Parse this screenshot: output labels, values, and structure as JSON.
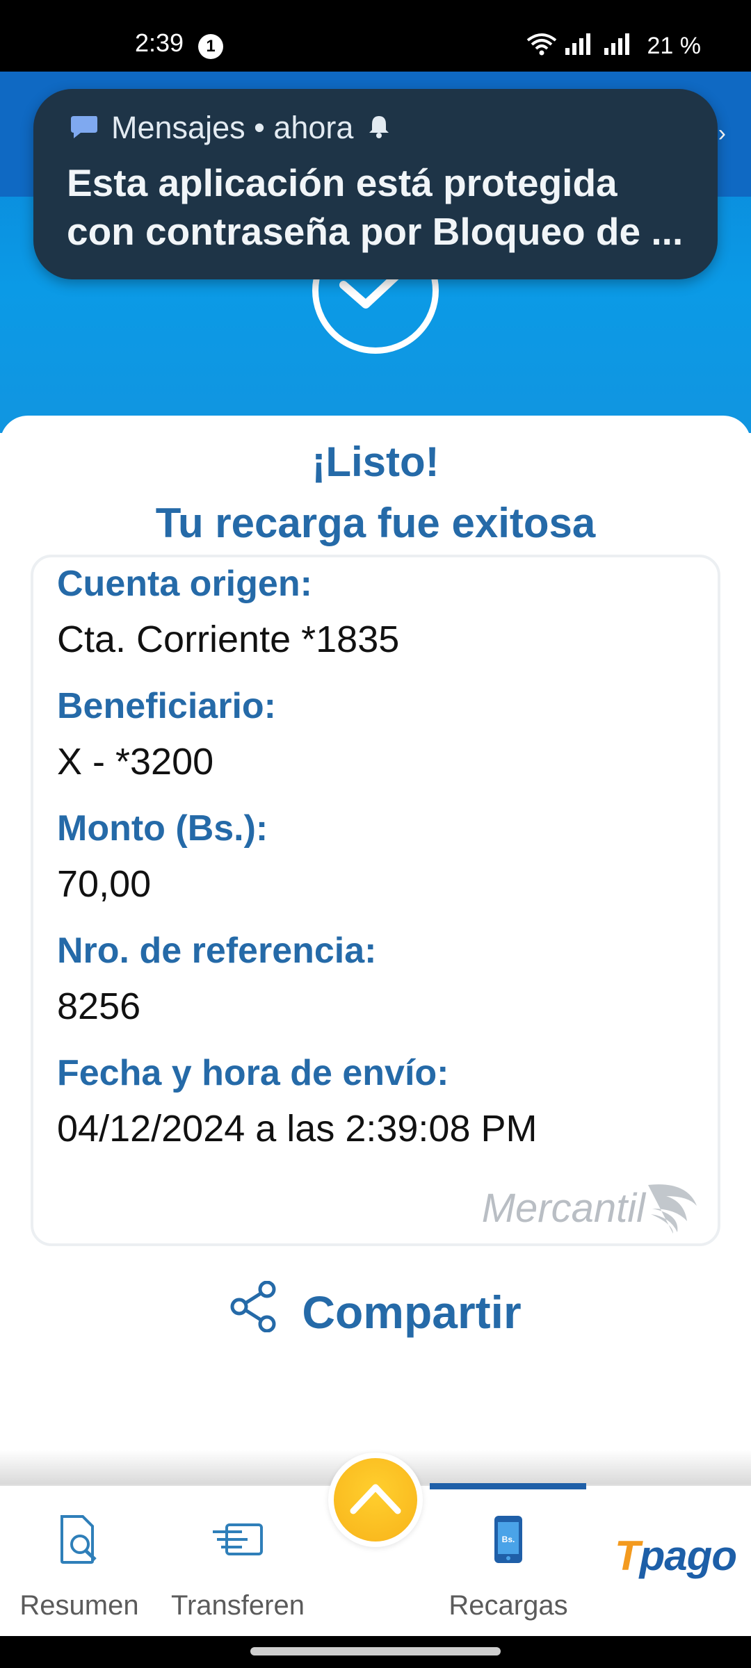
{
  "status_bar": {
    "time": "2:39",
    "notification_count": "1",
    "battery": "21 %"
  },
  "notification": {
    "app": "Mensajes • ahora",
    "line1": "Esta aplicación está protegida",
    "line2": "con contraseña por Bloqueo de ..."
  },
  "result": {
    "title": "¡Listo!",
    "subtitle": "Tu recarga fue exitosa"
  },
  "details": {
    "account_label": "Cuenta origen:",
    "account_value": "Cta. Corriente *1835",
    "beneficiary_label": "Beneficiario:",
    "beneficiary_value": "X - *3200",
    "amount_label": "Monto (Bs.):",
    "amount_value": "70,00",
    "reference_label": "Nro. de referencia:",
    "reference_value": "8256",
    "date_label": "Fecha y hora de envío:",
    "date_value": "04/12/2024 a las 2:39:08 PM",
    "brand": "Mercantil"
  },
  "actions": {
    "share_label": "Compartir"
  },
  "bottom_nav": {
    "items": [
      {
        "label": "Resumen"
      },
      {
        "label": "Transferen"
      },
      {
        "label": "Recargas"
      }
    ],
    "brand_t": "T",
    "brand_rest": "pago",
    "recargas_icon_text": "Bs."
  },
  "colors": {
    "accent": "#256aa8",
    "header_blue": "#0b9ae6",
    "notification_bg": "#1e3447",
    "fab_yellow": "#f8b31a"
  }
}
